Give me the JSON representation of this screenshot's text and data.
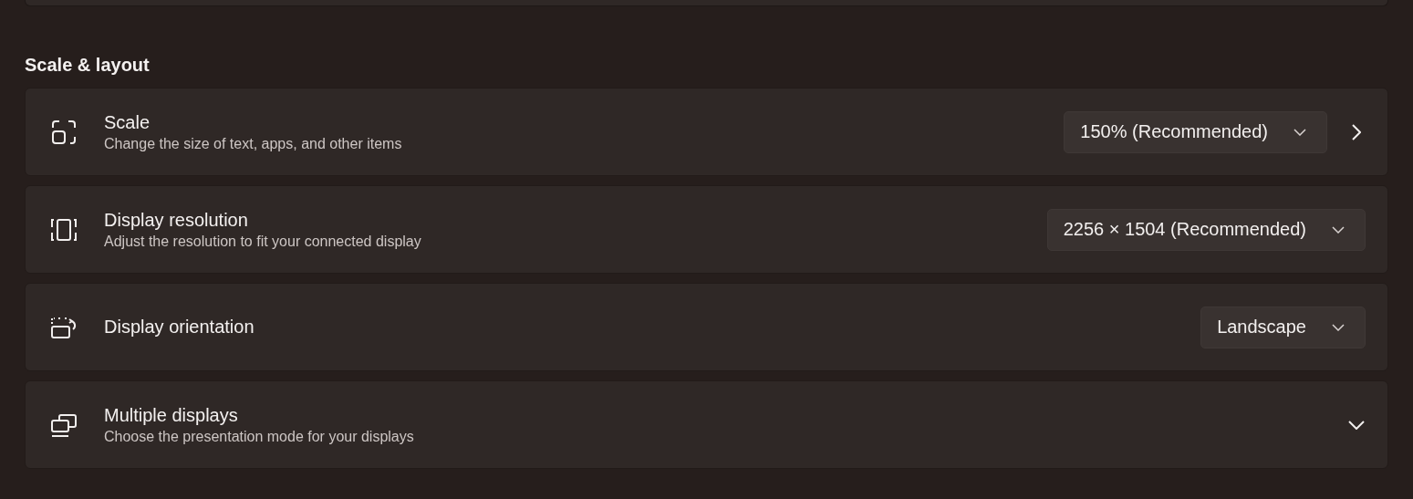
{
  "section": {
    "title": "Scale & layout"
  },
  "settings": [
    {
      "kind": "link",
      "title": "Scale",
      "description": "Change the size of text, apps, and other items",
      "dropdown": "150% (Recommended)"
    },
    {
      "kind": "plain",
      "title": "Display resolution",
      "description": "Adjust the resolution to fit your connected display",
      "dropdown": "2256 × 1504 (Recommended)"
    },
    {
      "kind": "plain",
      "title": "Display orientation",
      "dropdown": "Landscape"
    },
    {
      "kind": "expander",
      "title": "Multiple displays",
      "description": "Choose the presentation mode for your displays",
      "expanded": false
    }
  ]
}
